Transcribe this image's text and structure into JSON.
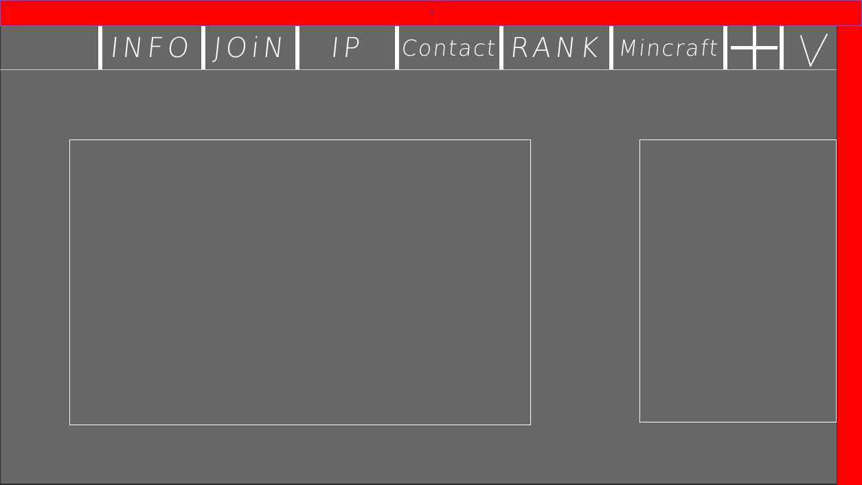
{
  "topbar": {
    "close_label": "×",
    "color": "#ff0000"
  },
  "nav": {
    "items": [
      {
        "label": "INFO"
      },
      {
        "label": "JOiN"
      },
      {
        "label": "IP"
      },
      {
        "label": "Contact"
      },
      {
        "label": "RANK"
      },
      {
        "label": "Mincraft"
      }
    ],
    "icons": [
      "plus-icon",
      "v-icon"
    ]
  },
  "colors": {
    "background": "#676767",
    "accent": "#ff0000",
    "nav_text": "#ffffff"
  }
}
